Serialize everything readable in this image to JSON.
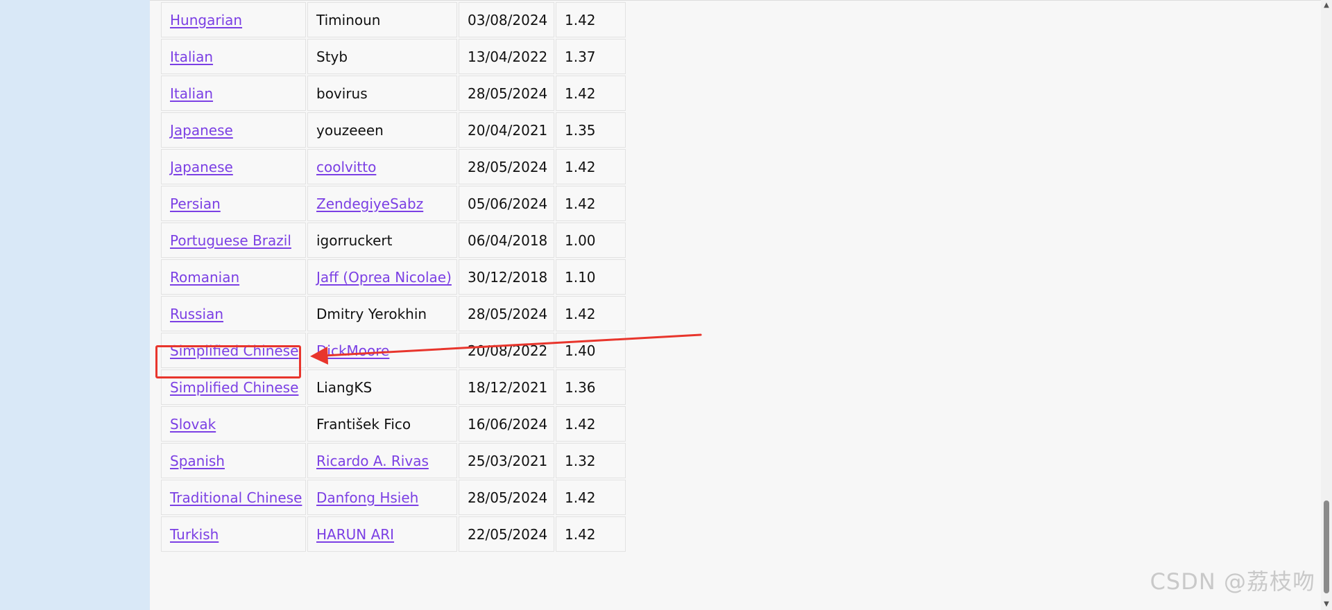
{
  "translations": [
    {
      "language": "Hungarian",
      "translator": "Timinoun",
      "translator_link": false,
      "date": "03/08/2024",
      "version": "1.42"
    },
    {
      "language": "Italian",
      "translator": "Styb",
      "translator_link": false,
      "date": "13/04/2022",
      "version": "1.37"
    },
    {
      "language": "Italian",
      "translator": "bovirus",
      "translator_link": false,
      "date": "28/05/2024",
      "version": "1.42"
    },
    {
      "language": "Japanese",
      "translator": "youzeeen",
      "translator_link": false,
      "date": "20/04/2021",
      "version": "1.35"
    },
    {
      "language": "Japanese",
      "translator": "coolvitto",
      "translator_link": true,
      "date": "28/05/2024",
      "version": "1.42"
    },
    {
      "language": "Persian",
      "translator": "ZendegiyeSabz",
      "translator_link": true,
      "date": "05/06/2024",
      "version": "1.42"
    },
    {
      "language": "Portuguese Brazil",
      "translator": "igorruckert",
      "translator_link": false,
      "date": "06/04/2018",
      "version": "1.00"
    },
    {
      "language": "Romanian",
      "translator": "Jaff (Oprea Nicolae)",
      "translator_link": true,
      "date": "30/12/2018",
      "version": "1.10"
    },
    {
      "language": "Russian",
      "translator": "Dmitry Yerokhin",
      "translator_link": false,
      "date": "28/05/2024",
      "version": "1.42"
    },
    {
      "language": "Simplified Chinese",
      "translator": "DickMoore",
      "translator_link": true,
      "date": "20/08/2022",
      "version": "1.40"
    },
    {
      "language": "Simplified Chinese",
      "translator": "LiangKS",
      "translator_link": false,
      "date": "18/12/2021",
      "version": "1.36"
    },
    {
      "language": "Slovak",
      "translator": "František Fico",
      "translator_link": false,
      "date": "16/06/2024",
      "version": "1.42"
    },
    {
      "language": "Spanish",
      "translator": "Ricardo A. Rivas",
      "translator_link": true,
      "date": "25/03/2021",
      "version": "1.32"
    },
    {
      "language": "Traditional Chinese",
      "translator": "Danfong Hsieh",
      "translator_link": true,
      "date": "28/05/2024",
      "version": "1.42"
    },
    {
      "language": "Turkish",
      "translator": "HARUN ARI",
      "translator_link": true,
      "date": "22/05/2024",
      "version": "1.42"
    }
  ],
  "colors": {
    "link": "#7b3fe4",
    "annotation": "#e8352c",
    "sidebar": "#d9e8f7"
  },
  "icons": {
    "scroll_up": "scroll-up-arrow-icon",
    "scroll_down": "scroll-down-arrow-icon",
    "annotation_arrow": "annotation-arrow-icon"
  },
  "watermark": "CSDN @荔枝吻"
}
